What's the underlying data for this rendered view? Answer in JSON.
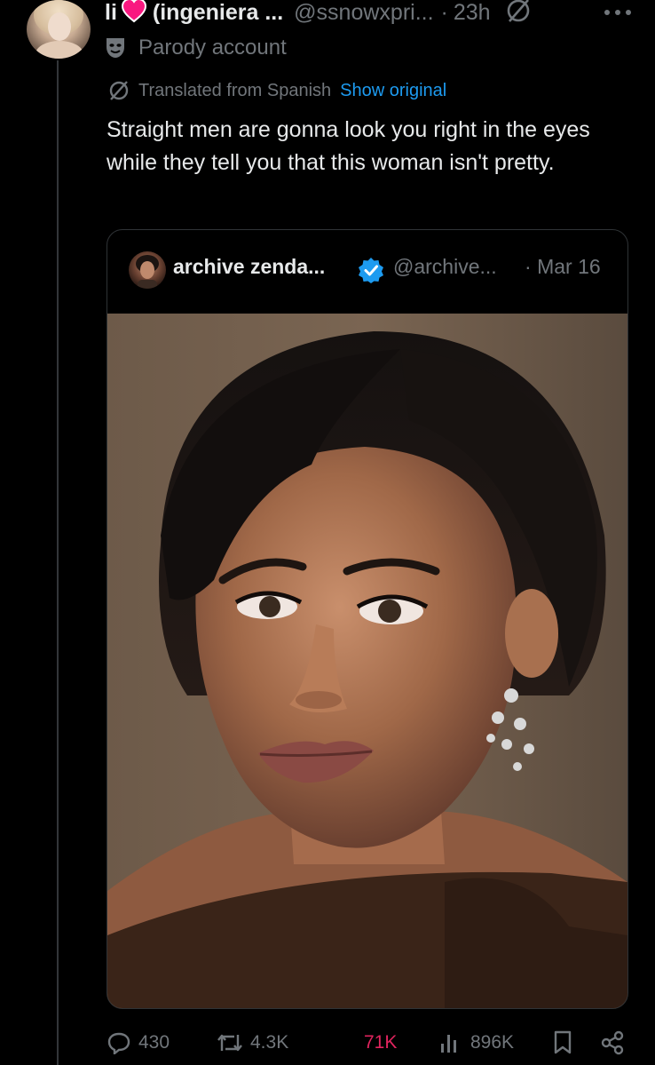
{
  "author": {
    "name": "li",
    "name_suffix": "(ingeniera ...",
    "handle": "@ssnowxpri...",
    "separator": "·",
    "time": "23h",
    "label": "Parody account"
  },
  "translation": {
    "notice": "Translated from Spanish",
    "link": "Show original"
  },
  "tweet": {
    "text": "Straight men are gonna look you right in the eyes while they tell you that this woman isn't pretty."
  },
  "quoted": {
    "name": "archive zenda...",
    "handle": "@archive...",
    "separator": "·",
    "date": "Mar 16",
    "verified_color": "#1d9bf0"
  },
  "actions": {
    "replies": "430",
    "reposts": "4.3K",
    "likes_badge": "71K",
    "views": "896K"
  },
  "colors": {
    "background": "#000000",
    "text": "#e7e9ea",
    "muted": "#71767b",
    "link": "#1d9bf0",
    "heart": "#f91880"
  },
  "icons": [
    "heart-icon",
    "grok-icon",
    "more-icon",
    "parody-mask-icon",
    "translate-icon",
    "verified-badge-icon",
    "reply-icon",
    "repost-icon",
    "views-icon",
    "bookmark-icon",
    "share-icon"
  ]
}
